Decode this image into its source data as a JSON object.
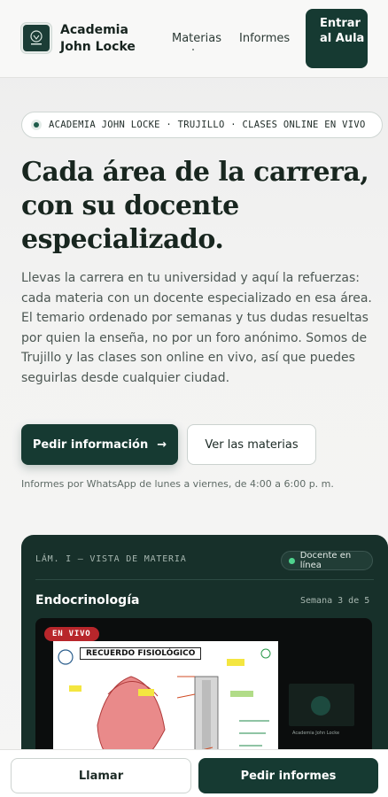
{
  "header": {
    "brand": "Academia John Locke",
    "nav": {
      "materias": "Materias",
      "informes": "Informes"
    },
    "enter_button": "Entrar al Aula"
  },
  "badge": {
    "text": "ACADEMIA JOHN LOCKE · TRUJILLO · CLASES ONLINE EN VIVO"
  },
  "hero": {
    "title": "Cada área de la carrera, con su docente especializado.",
    "description": "Llevas la carrera en tu universidad y aquí la refuerzas: cada materia con un docente especializado en esa área. El temario ordenado por semanas y tus dudas resueltas por quien la enseña, no por un foro anónimo. Somos de Trujillo y las clases son online en vivo, así que puedes seguirlas desde cualquier ciudad.",
    "primary_button": "Pedir información",
    "primary_arrow": "→",
    "secondary_button": "Ver las materias",
    "hours_note": "Informes por WhatsApp de lunes a viernes, de 4:00 a 6:00 p. m."
  },
  "card": {
    "label": "LÁM. I — VISTA DE MATERIA",
    "status": "Docente en línea",
    "subject": "Endocrinología",
    "week": "Semana 3 de 5",
    "live": "EN VIVO",
    "slide_title": "RECUERDO FISIOLÓGICO",
    "cam_caption": "Academia John Locke"
  },
  "bottom_bar": {
    "call": "Llamar",
    "info": "Pedir informes"
  },
  "colors": {
    "primary": "#163a32",
    "live": "#b8262b",
    "online": "#4fd38d"
  }
}
